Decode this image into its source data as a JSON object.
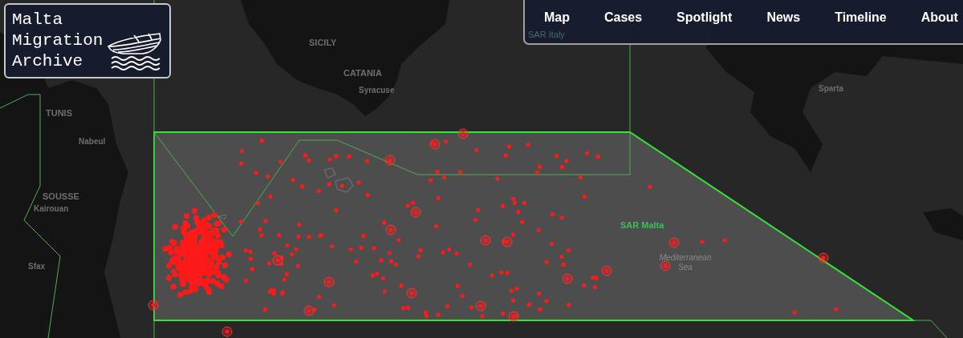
{
  "logo": {
    "lines": [
      "Malta",
      "Migration",
      "Archive"
    ]
  },
  "nav": [
    {
      "label": "Map"
    },
    {
      "label": "Cases"
    },
    {
      "label": "Spotlight"
    },
    {
      "label": "News"
    },
    {
      "label": "Timeline"
    },
    {
      "label": "About"
    }
  ],
  "map": {
    "labels": [
      {
        "kind": "city",
        "text": "SICILY"
      },
      {
        "kind": "city",
        "text": "CATANIA"
      },
      {
        "kind": "town",
        "text": "Syracuse"
      },
      {
        "kind": "city",
        "text": "TUNIS"
      },
      {
        "kind": "town",
        "text": "Nabeul"
      },
      {
        "kind": "city",
        "text": "SOUSSE"
      },
      {
        "kind": "town",
        "text": "Kairouan"
      },
      {
        "kind": "town",
        "text": "Sfax"
      },
      {
        "kind": "town",
        "text": "Sparta"
      },
      {
        "kind": "sar",
        "text": "SAR Malta"
      },
      {
        "kind": "sea",
        "text": "Mediterranean Sea"
      },
      {
        "kind": "sar-faint",
        "text": "SAR Italy"
      }
    ]
  }
}
